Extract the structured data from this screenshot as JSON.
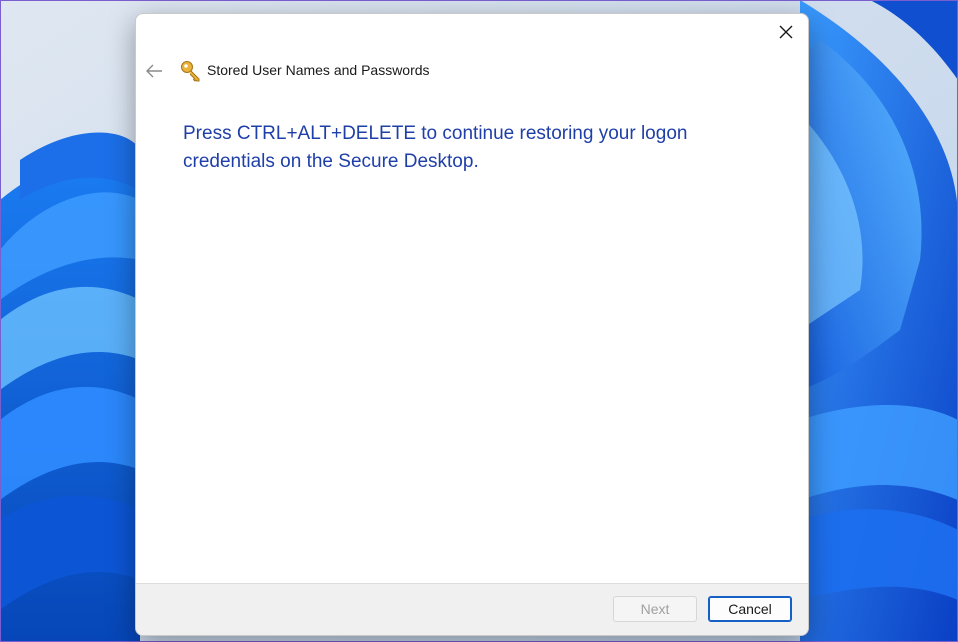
{
  "dialog": {
    "title": "Stored User Names and Passwords",
    "instruction": "Press CTRL+ALT+DELETE to continue restoring your logon credentials on the Secure Desktop.",
    "icons": {
      "back": "back-arrow-icon",
      "close": "close-icon",
      "app": "key-icon"
    }
  },
  "footer": {
    "next_label": "Next",
    "cancel_label": "Cancel",
    "next_enabled": false
  },
  "colors": {
    "instruction_text": "#1f3fa8",
    "accent": "#1560c4",
    "wallpaper_blue": "#0a5fe0"
  }
}
